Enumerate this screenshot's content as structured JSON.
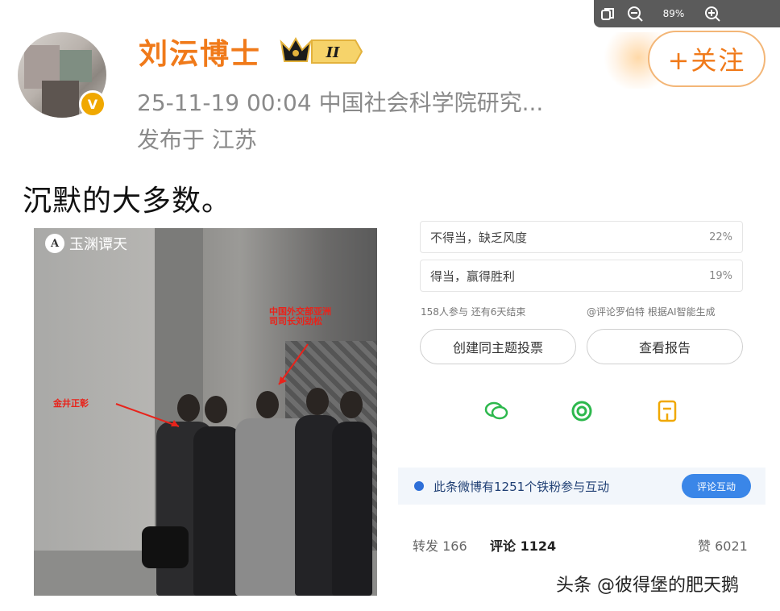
{
  "viewer_toolbar": {
    "zoom_level": "89%"
  },
  "header": {
    "username": "刘沄博士",
    "level_badge": "II",
    "timestamp_source": "25-11-19 00:04  中国社会科学院研究...",
    "location": "发布于 江苏",
    "follow_label": "+关注"
  },
  "post": {
    "text": "沉默的大多数。"
  },
  "photo": {
    "watermark": "玉渊谭天",
    "label_left": "金井正彰",
    "label_right": "中国外交部亚洲司司长刘劲松"
  },
  "poll": {
    "options": [
      {
        "label": "不得当，缺乏风度",
        "percent": "22%"
      },
      {
        "label": "得当，赢得胜利",
        "percent": "19%"
      }
    ],
    "stats_text": "158人参与 还有6天结束",
    "ai_note": "@评论罗伯特 根据AI智能生成",
    "create_button": "创建同主题投票",
    "report_button": "查看报告"
  },
  "fans_bar": {
    "text": "此条微博有1251个铁粉参与互动",
    "button": "评论互动"
  },
  "stats": {
    "repost": "转发 166",
    "comment": "评论 1124",
    "like": "赞 6021"
  },
  "source_watermark": "头条 @彼得堡的肥天鹅",
  "colors": {
    "orange": "#f07a1a",
    "blue": "#3a86e8",
    "gray_text": "#8a8a8a"
  }
}
